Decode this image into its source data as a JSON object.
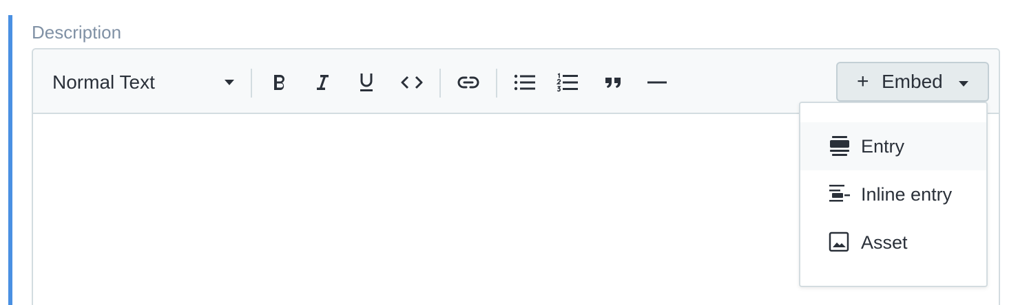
{
  "field": {
    "label": "Description"
  },
  "toolbar": {
    "heading_select": "Normal Text",
    "buttons": {
      "bold": "bold-icon",
      "italic": "italic-icon",
      "underline": "underline-icon",
      "code": "code-icon",
      "link": "link-icon",
      "bulleted_list": "bulleted-list-icon",
      "numbered_list": "numbered-list-icon",
      "quote": "quote-icon",
      "horizontal_rule": "horizontal-rule-icon"
    },
    "embed": {
      "plus": "+",
      "label": "Embed"
    }
  },
  "embed_menu": {
    "items": [
      {
        "label": "Entry",
        "icon": "entry-icon",
        "highlighted": true
      },
      {
        "label": "Inline entry",
        "icon": "inline-entry-icon",
        "highlighted": false
      },
      {
        "label": "Asset",
        "icon": "asset-icon",
        "highlighted": false
      }
    ]
  },
  "colors": {
    "focus_bar": "#4a90e2",
    "label": "#8091a5",
    "toolbar_bg": "#f7f9fa",
    "border": "#d3dce0",
    "embed_bg": "#e5ebed",
    "text": "#2a3039"
  }
}
